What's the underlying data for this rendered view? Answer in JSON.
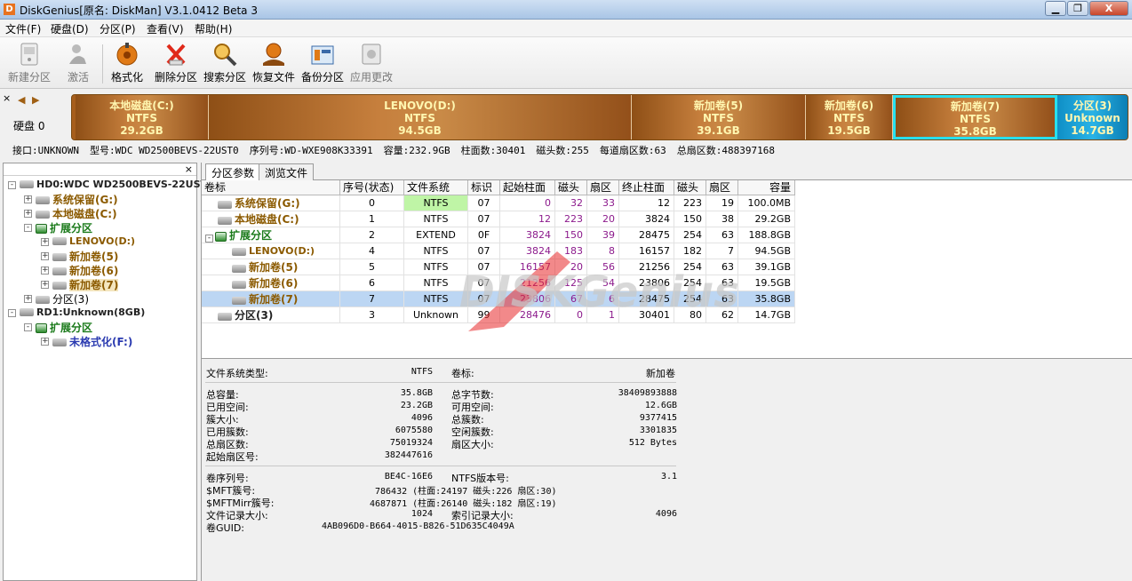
{
  "window": {
    "title": "DiskGenius[原名: DiskMan] V3.1.0412 Beta 3",
    "min_glyph": "▁",
    "max_glyph": "❐",
    "close_glyph": "X"
  },
  "menu": [
    "文件(F)",
    "硬盘(D)",
    "分区(P)",
    "查看(V)",
    "帮助(H)"
  ],
  "toolbar": [
    {
      "label": "新建分区",
      "icon": "new-partition-icon",
      "enabled": false
    },
    {
      "label": "激活",
      "icon": "activate-icon",
      "enabled": false
    },
    {
      "label": "格式化",
      "icon": "format-icon",
      "enabled": true
    },
    {
      "label": "删除分区",
      "icon": "delete-partition-icon",
      "enabled": true
    },
    {
      "label": "搜索分区",
      "icon": "search-partition-icon",
      "enabled": true
    },
    {
      "label": "恢复文件",
      "icon": "recover-files-icon",
      "enabled": true
    },
    {
      "label": "备份分区",
      "icon": "backup-partition-icon",
      "enabled": true
    },
    {
      "label": "应用更改",
      "icon": "apply-changes-icon",
      "enabled": false
    }
  ],
  "diskbar": {
    "close": "×",
    "disk_label": "硬盘 0",
    "segments": [
      {
        "name": "本地磁盘(C:)",
        "fs": "NTFS",
        "size": "29.2GB"
      },
      {
        "name": "LENOVO(D:)",
        "fs": "NTFS",
        "size": "94.5GB"
      },
      {
        "name": "新加卷(5)",
        "fs": "NTFS",
        "size": "39.1GB"
      },
      {
        "name": "新加卷(6)",
        "fs": "NTFS",
        "size": "19.5GB"
      },
      {
        "name": "新加卷(7)",
        "fs": "NTFS",
        "size": "35.8GB"
      },
      {
        "name": "分区(3)",
        "fs": "Unknown",
        "size": "14.7GB"
      }
    ]
  },
  "disk_info": [
    "接口:UNKNOWN",
    "型号:WDC WD2500BEVS-22UST0",
    "序列号:WD-WXE908K33391",
    "容量:232.9GB",
    "柱面数:30401",
    "磁头数:255",
    "每道扇区数:63",
    "总扇区数:488397168"
  ],
  "tree": {
    "close": "×",
    "nodes": [
      {
        "text": "HD0:WDC WD2500BEVS-22UST0",
        "box": "-"
      },
      {
        "text": "系统保留(G:)",
        "box": "+"
      },
      {
        "text": "本地磁盘(C:)",
        "box": "+"
      },
      {
        "text": "扩展分区",
        "box": "-"
      },
      {
        "text": "LENOVO(D:)",
        "box": "+"
      },
      {
        "text": "新加卷(5)",
        "box": "+"
      },
      {
        "text": "新加卷(6)",
        "box": "+"
      },
      {
        "text": "新加卷(7)",
        "box": "+"
      },
      {
        "text": "分区(3)",
        "box": "+"
      },
      {
        "text": "RD1:Unknown(8GB)",
        "box": "-"
      },
      {
        "text": "扩展分区",
        "box": "-"
      },
      {
        "text": "未格式化(F:)",
        "box": "+"
      }
    ]
  },
  "tabs": [
    "分区参数",
    "浏览文件"
  ],
  "columns": [
    "卷标",
    "序号(状态)",
    "文件系统",
    "标识",
    "起始柱面",
    "磁头",
    "扇区",
    "终止柱面",
    "磁头",
    "扇区",
    "容量"
  ],
  "rows": [
    [
      "系统保留(G:)",
      "0",
      "NTFS",
      "07",
      "0",
      "32",
      "33",
      "12",
      "223",
      "19",
      "100.0MB"
    ],
    [
      "本地磁盘(C:)",
      "1",
      "NTFS",
      "07",
      "12",
      "223",
      "20",
      "3824",
      "150",
      "38",
      "29.2GB"
    ],
    [
      "扩展分区",
      "2",
      "EXTEND",
      "0F",
      "3824",
      "150",
      "39",
      "28475",
      "254",
      "63",
      "188.8GB"
    ],
    [
      "LENOVO(D:)",
      "4",
      "NTFS",
      "07",
      "3824",
      "183",
      "8",
      "16157",
      "182",
      "7",
      "94.5GB"
    ],
    [
      "新加卷(5)",
      "5",
      "NTFS",
      "07",
      "16157",
      "20",
      "56",
      "21256",
      "254",
      "63",
      "39.1GB"
    ],
    [
      "新加卷(6)",
      "6",
      "NTFS",
      "07",
      "21256",
      "125",
      "54",
      "23806",
      "254",
      "63",
      "19.5GB"
    ],
    [
      "新加卷(7)",
      "7",
      "NTFS",
      "07",
      "23806",
      "67",
      "6",
      "28475",
      "254",
      "63",
      "35.8GB"
    ],
    [
      "分区(3)",
      "3",
      "Unknown",
      "99",
      "28476",
      "0",
      "1",
      "30401",
      "80",
      "62",
      "14.7GB"
    ]
  ],
  "watermark": "DISKGenius",
  "details": {
    "fs_type_label": "文件系统类型:",
    "fs_type": "NTFS",
    "volume_label_label": "卷标:",
    "volume_label": "新加卷",
    "left1": [
      [
        "总容量:",
        "35.8GB"
      ],
      [
        "已用空间:",
        "23.2GB"
      ],
      [
        "簇大小:",
        "4096"
      ],
      [
        "已用簇数:",
        "6075580"
      ],
      [
        "总扇区数:",
        "75019324"
      ],
      [
        "起始扇区号:",
        "382447616"
      ]
    ],
    "right1": [
      [
        "总字节数:",
        "38409893888"
      ],
      [
        "可用空间:",
        "12.6GB"
      ],
      [
        "总簇数:",
        "9377415"
      ],
      [
        "空闲簇数:",
        "3301835"
      ],
      [
        "扇区大小:",
        "512 Bytes"
      ]
    ],
    "serial_label": "卷序列号:",
    "serial": "BE4C-16E6",
    "ntfs_ver_label": "NTFS版本号:",
    "ntfs_ver": "3.1",
    "mft_label": "$MFT簇号:",
    "mft": "786432 (柱面:24197 磁头:226 扇区:30)",
    "mftmirr_label": "$MFTMirr簇号:",
    "mftmirr": "4687871 (柱面:26140 磁头:182 扇区:19)",
    "frs_label": "文件记录大小:",
    "frs": "1024",
    "irs_label": "索引记录大小:",
    "irs": "4096",
    "guid_label": "卷GUID:",
    "guid": "4AB096D0-B664-4015-B826-51D635C4049A"
  }
}
